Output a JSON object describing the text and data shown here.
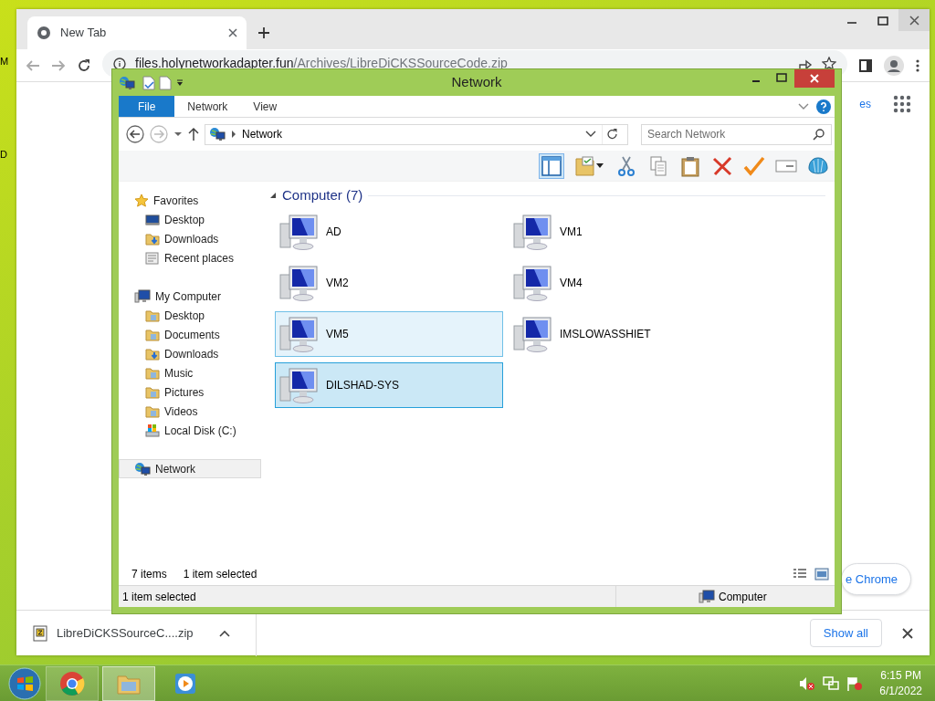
{
  "desktop": {
    "edge_labels": [
      "M",
      "D"
    ]
  },
  "browser": {
    "tab": {
      "title": "New Tab",
      "selected": true
    },
    "url": "files.holynetworkadapter.fun/Archives/LibreDiCKSSourceCode.zip",
    "page_link": "es",
    "customize_button": "e Chrome",
    "download": {
      "filename": "LibreDiCKSSourceC....zip"
    },
    "show_all": "Show all"
  },
  "explorer": {
    "title": "Network",
    "ribbon_tabs": [
      {
        "label": "File",
        "selected": true
      },
      {
        "label": "Network",
        "selected": false
      },
      {
        "label": "View",
        "selected": false
      }
    ],
    "address": "Network",
    "search": {
      "placeholder": "Search Network"
    },
    "nav": [
      {
        "label": "Favorites",
        "kind": "star",
        "selected": false,
        "children": [
          {
            "label": "Desktop",
            "kind": "desktop",
            "selected": false
          },
          {
            "label": "Downloads",
            "kind": "downloads",
            "selected": false
          },
          {
            "label": "Recent places",
            "kind": "recent",
            "selected": false
          }
        ]
      },
      {
        "label": "My Computer",
        "kind": "computer",
        "selected": false,
        "children": [
          {
            "label": "Desktop",
            "kind": "folder",
            "selected": false
          },
          {
            "label": "Documents",
            "kind": "folder",
            "selected": false
          },
          {
            "label": "Downloads",
            "kind": "downloads",
            "selected": false
          },
          {
            "label": "Music",
            "kind": "folder",
            "selected": false
          },
          {
            "label": "Pictures",
            "kind": "folder",
            "selected": false
          },
          {
            "label": "Videos",
            "kind": "folder",
            "selected": false
          },
          {
            "label": "Local Disk (C:)",
            "kind": "drive",
            "selected": false
          }
        ]
      },
      {
        "label": "Network",
        "kind": "network",
        "selected": true
      }
    ],
    "group": {
      "title": "Computer (7)",
      "expanded": true
    },
    "items": [
      {
        "label": "AD",
        "selected": false,
        "hot": false
      },
      {
        "label": "VM1",
        "selected": false,
        "hot": false
      },
      {
        "label": "VM2",
        "selected": false,
        "hot": false
      },
      {
        "label": "VM4",
        "selected": false,
        "hot": false
      },
      {
        "label": "VM5",
        "selected": false,
        "hot": true
      },
      {
        "label": "IMSLOWASSHIET",
        "selected": false,
        "hot": false
      },
      {
        "label": "DILSHAD-SYS",
        "selected": true,
        "hot": false
      }
    ],
    "item_count": "7 items",
    "selection_info": "1 item selected",
    "status_bar": {
      "left": "1 item selected",
      "right": "Computer"
    }
  },
  "taskbar": {
    "apps": [
      {
        "kind": "chrome",
        "open": true,
        "active": false
      },
      {
        "kind": "explorer",
        "open": true,
        "active": true
      },
      {
        "kind": "media",
        "open": false,
        "active": false
      }
    ],
    "time": "6:15 PM",
    "date": "6/1/2022"
  }
}
